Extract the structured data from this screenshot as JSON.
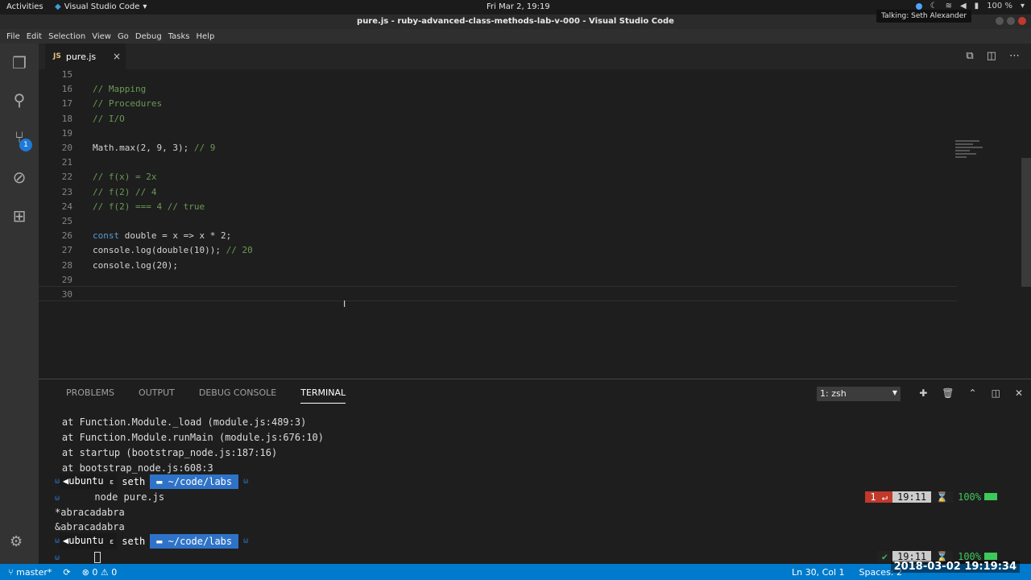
{
  "os": {
    "activities": "Activities",
    "app_name": "Visual Studio Code",
    "clock": "Fri Mar  2, 19:19",
    "battery": "100 %",
    "talking": "Talking: Seth Alexander"
  },
  "window": {
    "title": "pure.js - ruby-advanced-class-methods-lab-v-000 - Visual Studio Code"
  },
  "menu": [
    "File",
    "Edit",
    "Selection",
    "View",
    "Go",
    "Debug",
    "Tasks",
    "Help"
  ],
  "activity_bar": {
    "scm_badge": "1"
  },
  "tab": {
    "name": "pure.js",
    "icon_text": "JS",
    "close": "×"
  },
  "editor": {
    "lines": [
      {
        "n": "15",
        "text": "",
        "cls": ""
      },
      {
        "n": "16",
        "text": "// Mapping",
        "cls": "cm"
      },
      {
        "n": "17",
        "text": "// Procedures",
        "cls": "cm"
      },
      {
        "n": "18",
        "text": "// I/O",
        "cls": "cm"
      },
      {
        "n": "19",
        "text": "",
        "cls": ""
      },
      {
        "n": "20",
        "text": "Math.max(2, 9, 3); ",
        "cls": "",
        "tail": "// 9"
      },
      {
        "n": "21",
        "text": "",
        "cls": ""
      },
      {
        "n": "22",
        "text": "// f(x) = 2x",
        "cls": "cm"
      },
      {
        "n": "23",
        "text": "// f(2) // 4",
        "cls": "cm"
      },
      {
        "n": "24",
        "text": "// f(2) === 4 // true",
        "cls": "cm"
      },
      {
        "n": "25",
        "text": "",
        "cls": ""
      },
      {
        "n": "26",
        "kw": "const",
        "text": " double = x => x * 2;",
        "cls": ""
      },
      {
        "n": "27",
        "text": "console.log(double(10)); ",
        "cls": "",
        "tail": "// 20"
      },
      {
        "n": "28",
        "text": "console.log(20);",
        "cls": ""
      },
      {
        "n": "29",
        "text": "",
        "cls": ""
      },
      {
        "n": "30",
        "text": "",
        "cls": ""
      }
    ]
  },
  "panel": {
    "tabs": [
      "PROBLEMS",
      "OUTPUT",
      "DEBUG CONSOLE",
      "TERMINAL"
    ],
    "active_tab": "TERMINAL",
    "terminal_select": "1: zsh",
    "terminal": {
      "stack": [
        "    at Function.Module._load (module.js:489:3)",
        "    at Function.Module.runMain (module.js:676:10)",
        "    at startup (bootstrap_node.js:187:16)",
        "    at bootstrap_node.js:608:3"
      ],
      "prompt_os": "ubuntu",
      "prompt_sep": "ε",
      "prompt_user": "seth",
      "prompt_dir": "~/code/labs",
      "command": "node pure.js",
      "output": [
        "*abracadabra",
        "&abracadabra"
      ],
      "right1": {
        "err": "1 ↵",
        "time": "19:11",
        "bat": "100%"
      },
      "right2": {
        "time": "19:11",
        "bat": "100%"
      }
    }
  },
  "status": {
    "branch": "master*",
    "errors": "0",
    "warnings": "0",
    "position": "Ln 30, Col 1",
    "spaces": "Spaces: 2",
    "timestamp": "2018-03-02 19:19:34"
  }
}
